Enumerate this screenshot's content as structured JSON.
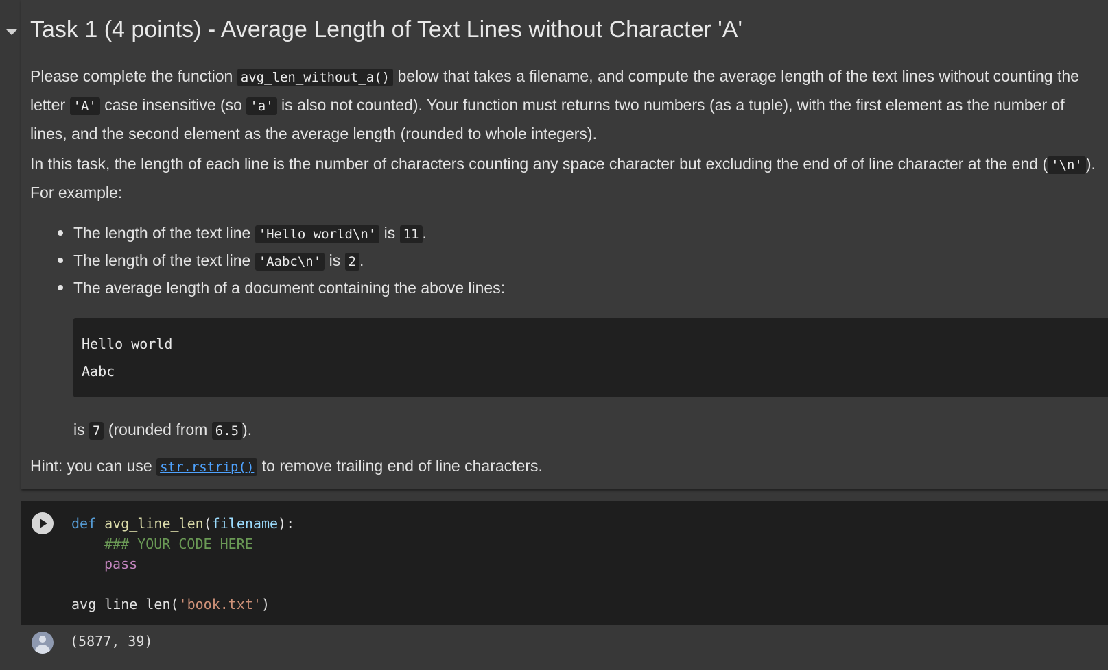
{
  "text_cell": {
    "heading": "Task 1 (4 points) - Average Length of Text Lines without Character 'A'",
    "p1": {
      "a": "Please complete the function ",
      "code_func": "avg_len_without_a()",
      "b": " below that takes a filename, and compute the average length of the text lines without counting the letter ",
      "code_A": "'A'",
      "c": " case insensitive (so ",
      "code_a": "'a'",
      "d": " is also not counted). Your function must returns two numbers (as a tuple), with the first element as the number of lines, and the second element as the average length (rounded to whole integers)."
    },
    "p2": {
      "a": "In this task, the length of each line is the number of characters counting any space character but excluding the end of of line character at the end (",
      "code_nl": "'\\n'",
      "b": "). For example:"
    },
    "bullets": [
      {
        "a": "The length of the text line ",
        "code": "'Hello world\\n'",
        "b": " is ",
        "code2": "11",
        "c": "."
      },
      {
        "a": "The length of the text line ",
        "code": "'Aabc\\n'",
        "b": " is ",
        "code2": "2",
        "c": "."
      },
      {
        "a": "The average length of a document containing the above lines:"
      }
    ],
    "example_lines": [
      "Hello world",
      "Aabc"
    ],
    "result": {
      "a": "is ",
      "code": "7",
      "b": " (rounded from ",
      "code2": "6.5",
      "c": ")."
    },
    "hint": {
      "a": "Hint: you can use ",
      "link": "str.rstrip()",
      "b": " to remove trailing end of line characters."
    }
  },
  "code_cell": {
    "line1": {
      "def": "def",
      "fn": " avg_line_len",
      "open": "(",
      "param": "filename",
      "close": "):"
    },
    "line2_comment": "### YOUR CODE HERE",
    "line3_pass": "pass",
    "line5": {
      "call": "avg_line_len(",
      "arg": "'book.txt'",
      "close": ")"
    },
    "output": "(5877, 39)"
  }
}
